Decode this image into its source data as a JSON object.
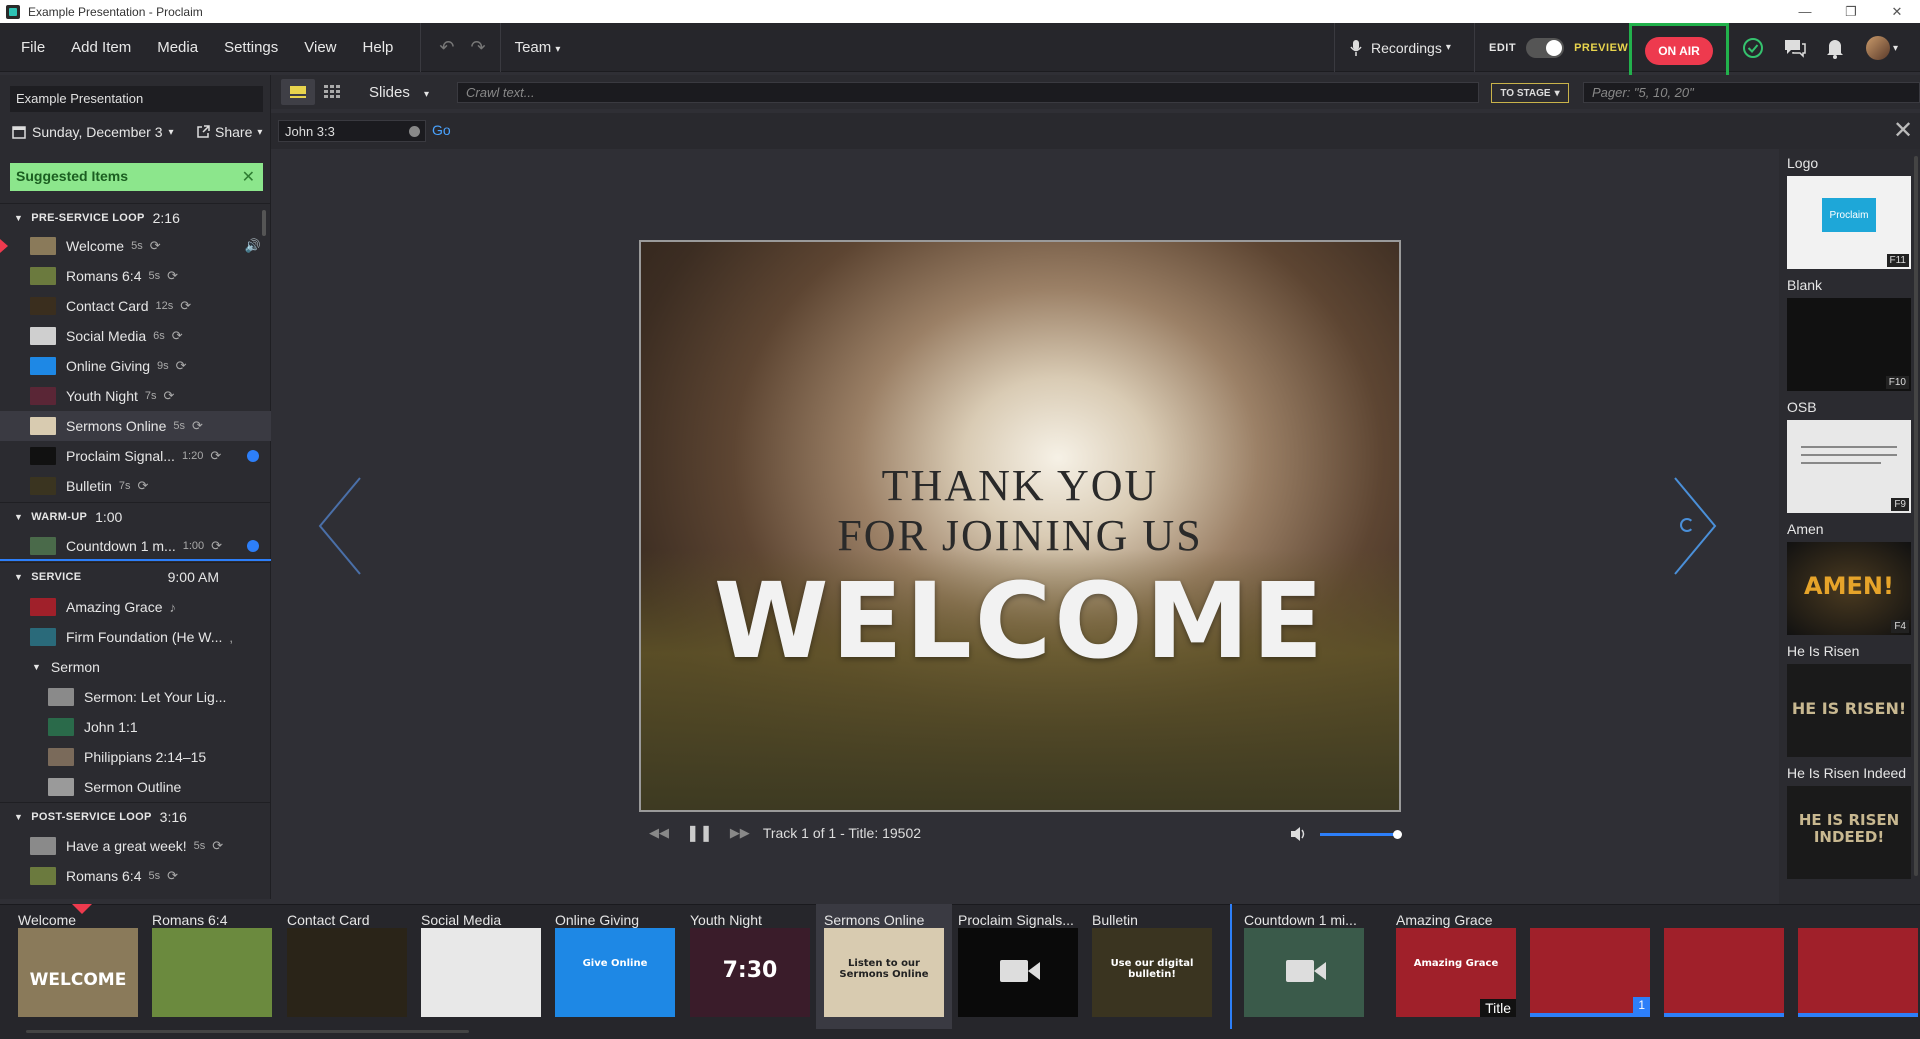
{
  "window": {
    "title": "Example Presentation - Proclaim",
    "controls": [
      "—",
      "❐",
      "✕"
    ]
  },
  "menu": {
    "items": [
      "File",
      "Add Item",
      "Media",
      "Settings",
      "View",
      "Help"
    ],
    "team": "Team",
    "recordings": "Recordings",
    "edit": "EDIT",
    "preview": "PREVIEW",
    "on_air": "ON AIR"
  },
  "toolbar": {
    "slides_label": "Slides",
    "crawl_placeholder": "Crawl text...",
    "to_stage": "TO STAGE",
    "pager_placeholder": "Pager: \"5, 10, 20\""
  },
  "sidebar": {
    "presentation_title": "Example Presentation",
    "date": "Sunday, December 3",
    "share": "Share",
    "suggested": "Suggested Items",
    "sections": [
      {
        "name": "PRE-SERVICE LOOP",
        "duration": "2:16"
      },
      {
        "name": "WARM-UP",
        "duration": "1:00"
      },
      {
        "name": "SERVICE",
        "duration": "9:00 AM"
      },
      {
        "name": "POST-SERVICE LOOP",
        "duration": "3:16"
      }
    ],
    "preservice": [
      {
        "label": "Welcome",
        "dur": "5s",
        "thumb": "#8a7a5a"
      },
      {
        "label": "Romans 6:4",
        "dur": "5s",
        "thumb": "#6b7a3e"
      },
      {
        "label": "Contact Card",
        "dur": "12s",
        "thumb": "#3a2e1e"
      },
      {
        "label": "Social Media",
        "dur": "6s",
        "thumb": "#cfcfcf"
      },
      {
        "label": "Online Giving",
        "dur": "9s",
        "thumb": "#1e88e5"
      },
      {
        "label": "Youth Night",
        "dur": "7s",
        "thumb": "#5a2636"
      },
      {
        "label": "Sermons Online",
        "dur": "5s",
        "thumb": "#d8cbb0"
      },
      {
        "label": "Proclaim Signal...",
        "dur": "1:20",
        "thumb": "#111111"
      },
      {
        "label": "Bulletin",
        "dur": "7s",
        "thumb": "#3a3420"
      }
    ],
    "warmup": [
      {
        "label": "Countdown 1 m...",
        "dur": "1:00",
        "thumb": "#4a6a4a"
      }
    ],
    "service": [
      {
        "label": "Amazing Grace",
        "note": "♪",
        "thumb": "#a0202a"
      },
      {
        "label": "Firm Foundation (He W...",
        "note": ",",
        "thumb": "#2a6a7a"
      }
    ],
    "sermon_group": "Sermon",
    "sermon": [
      {
        "label": "Sermon: Let Your Lig...",
        "thumb": "#8a8a8a"
      },
      {
        "label": "John 1:1",
        "thumb": "#2a6a4a"
      },
      {
        "label": "Philippians 2:14–15",
        "thumb": "#7a6a5a"
      },
      {
        "label": "Sermon Outline",
        "thumb": "#9a9a9a"
      }
    ],
    "postservice": [
      {
        "label": "Have a great week!",
        "dur": "5s",
        "thumb": "#8a8a8a"
      },
      {
        "label": "Romans 6:4",
        "dur": "5s",
        "thumb": "#6b7a3e"
      }
    ]
  },
  "verse": {
    "value": "John 3:3",
    "go": "Go"
  },
  "slide": {
    "line1": "THANK YOU",
    "line2": "FOR JOINING US",
    "line3": "WELCOME"
  },
  "media": {
    "track": "Track 1 of 1 - Title: 19502",
    "volume": 1.0
  },
  "right_panel": [
    {
      "label": "Logo",
      "key": "F11",
      "text": "Proclaim"
    },
    {
      "label": "Blank",
      "key": "F10",
      "text": ""
    },
    {
      "label": "OSB",
      "key": "F9",
      "text": ""
    },
    {
      "label": "Amen",
      "key": "F4",
      "text": "AMEN!"
    },
    {
      "label": "He Is Risen",
      "key": "",
      "text": "HE IS RISEN!"
    },
    {
      "label": "He Is Risen Indeed",
      "key": "",
      "text": "HE IS RISEN INDEED!"
    }
  ],
  "bottom": [
    {
      "label": "Welcome",
      "text": "WELCOME",
      "bg": "#8a7a5a"
    },
    {
      "label": "Romans 6:4",
      "text": "",
      "bg": "#6b8a3e"
    },
    {
      "label": "Contact Card",
      "text": "",
      "bg": "#2a2418"
    },
    {
      "label": "Social Media",
      "text": "",
      "bg": "#e8e8e8"
    },
    {
      "label": "Online Giving",
      "text": "Give Online",
      "bg": "#1e88e5"
    },
    {
      "label": "Youth Night",
      "text": "7:30",
      "bg": "#3a1c2a"
    },
    {
      "label": "Sermons Online",
      "text": "Listen to our Sermons Online",
      "bg": "#d8cbb0"
    },
    {
      "label": "Proclaim Signals...",
      "text": "",
      "bg": "#0a0a0a"
    },
    {
      "label": "Bulletin",
      "text": "Use our digital bulletin!",
      "bg": "#3a3420"
    },
    {
      "label": "Countdown 1 mi...",
      "text": "",
      "bg": "#3a5a4a"
    },
    {
      "label": "Amazing Grace",
      "text": "Amazing Grace",
      "bg": "#a0202a",
      "badge": "Title"
    },
    {
      "label": "",
      "text": "",
      "bg": "#a0202a",
      "badge": "1"
    },
    {
      "label": "",
      "text": "",
      "bg": "#a0202a",
      "badge": ""
    },
    {
      "label": "",
      "text": "",
      "bg": "#a0202a",
      "badge": ""
    }
  ]
}
